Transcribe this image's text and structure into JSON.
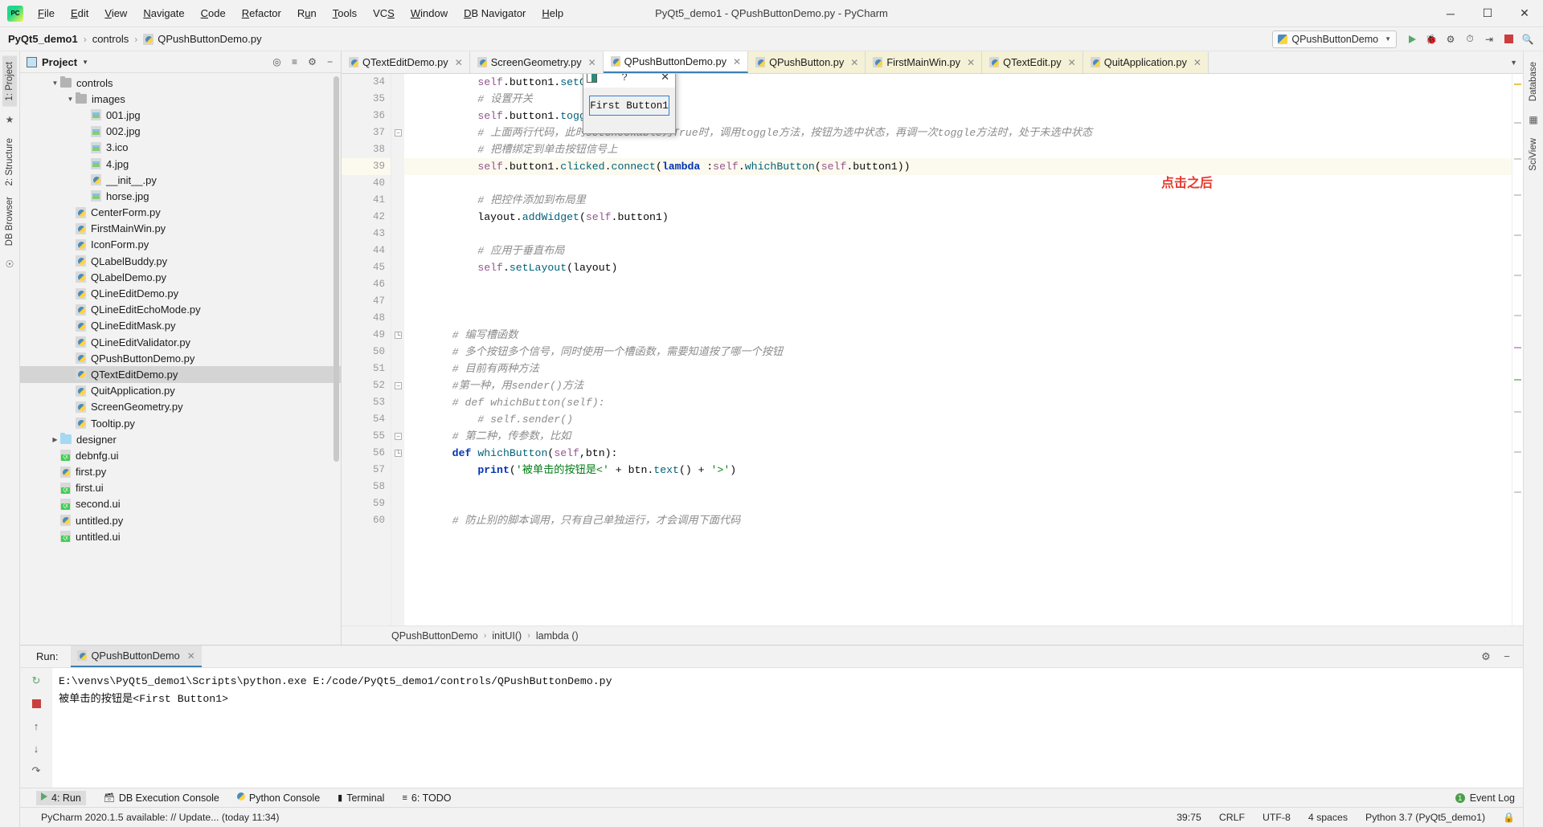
{
  "titlebar": {
    "logo_icon": "pycharm-logo-icon",
    "window_title": "PyQt5_demo1 - QPushButtonDemo.py - PyCharm",
    "menus": [
      "File",
      "Edit",
      "View",
      "Navigate",
      "Code",
      "Refactor",
      "Run",
      "Tools",
      "VCS",
      "Window",
      "DB Navigator",
      "Help"
    ],
    "minimize": "─",
    "maximize": "☐",
    "close": "✕"
  },
  "navbar": {
    "crumbs": [
      "PyQt5_demo1",
      "controls",
      "QPushButtonDemo.py"
    ],
    "separator": "›",
    "run_config": "QPushButtonDemo",
    "icons": [
      "run-icon",
      "debug-icon",
      "coverage-icon",
      "profile-icon",
      "attach-icon",
      "stop-icon",
      "search-icon"
    ]
  },
  "left_strip": {
    "project_tab": "1: Project",
    "structure_tab": "2: Structure",
    "db_browser_tab": "DB Browser"
  },
  "right_strip": {
    "database_tab": "Database",
    "sciview_tab": "SciView"
  },
  "project_panel": {
    "title": "Project",
    "tree": [
      {
        "label": "controls",
        "depth": 1,
        "type": "folder",
        "arrow": "▼",
        "selected": false
      },
      {
        "label": "images",
        "depth": 2,
        "type": "folder",
        "arrow": "▼",
        "selected": false
      },
      {
        "label": "001.jpg",
        "depth": 3,
        "type": "image",
        "arrow": "",
        "selected": false
      },
      {
        "label": "002.jpg",
        "depth": 3,
        "type": "image",
        "arrow": "",
        "selected": false
      },
      {
        "label": "3.ico",
        "depth": 3,
        "type": "image",
        "arrow": "",
        "selected": false
      },
      {
        "label": "4.jpg",
        "depth": 3,
        "type": "image",
        "arrow": "",
        "selected": false
      },
      {
        "label": "__init__.py",
        "depth": 3,
        "type": "python",
        "arrow": "",
        "selected": false
      },
      {
        "label": "horse.jpg",
        "depth": 3,
        "type": "image",
        "arrow": "",
        "selected": false
      },
      {
        "label": "CenterForm.py",
        "depth": 2,
        "type": "python",
        "arrow": "",
        "selected": false
      },
      {
        "label": "FirstMainWin.py",
        "depth": 2,
        "type": "python",
        "arrow": "",
        "selected": false
      },
      {
        "label": "IconForm.py",
        "depth": 2,
        "type": "python",
        "arrow": "",
        "selected": false
      },
      {
        "label": "QLabelBuddy.py",
        "depth": 2,
        "type": "python",
        "arrow": "",
        "selected": false
      },
      {
        "label": "QLabelDemo.py",
        "depth": 2,
        "type": "python",
        "arrow": "",
        "selected": false
      },
      {
        "label": "QLineEditDemo.py",
        "depth": 2,
        "type": "python",
        "arrow": "",
        "selected": false
      },
      {
        "label": "QLineEditEchoMode.py",
        "depth": 2,
        "type": "python",
        "arrow": "",
        "selected": false
      },
      {
        "label": "QLineEditMask.py",
        "depth": 2,
        "type": "python",
        "arrow": "",
        "selected": false
      },
      {
        "label": "QLineEditValidator.py",
        "depth": 2,
        "type": "python",
        "arrow": "",
        "selected": false
      },
      {
        "label": "QPushButtonDemo.py",
        "depth": 2,
        "type": "python",
        "arrow": "",
        "selected": false
      },
      {
        "label": "QTextEditDemo.py",
        "depth": 2,
        "type": "python",
        "arrow": "",
        "selected": true
      },
      {
        "label": "QuitApplication.py",
        "depth": 2,
        "type": "python",
        "arrow": "",
        "selected": false
      },
      {
        "label": "ScreenGeometry.py",
        "depth": 2,
        "type": "python",
        "arrow": "",
        "selected": false
      },
      {
        "label": "Tooltip.py",
        "depth": 2,
        "type": "python",
        "arrow": "",
        "selected": false
      },
      {
        "label": "designer",
        "depth": 1,
        "type": "folderblue",
        "arrow": "▶",
        "selected": false
      },
      {
        "label": "debnfg.ui",
        "depth": 1,
        "type": "qtui",
        "arrow": "",
        "selected": false
      },
      {
        "label": "first.py",
        "depth": 1,
        "type": "python",
        "arrow": "",
        "selected": false
      },
      {
        "label": "first.ui",
        "depth": 1,
        "type": "qtui",
        "arrow": "",
        "selected": false
      },
      {
        "label": "second.ui",
        "depth": 1,
        "type": "qtui",
        "arrow": "",
        "selected": false
      },
      {
        "label": "untitled.py",
        "depth": 1,
        "type": "python",
        "arrow": "",
        "selected": false
      },
      {
        "label": "untitled.ui",
        "depth": 1,
        "type": "qtui",
        "arrow": "",
        "selected": false
      }
    ]
  },
  "editor": {
    "tabs": [
      {
        "label": "QTextEditDemo.py",
        "active": false,
        "modified": false
      },
      {
        "label": "ScreenGeometry.py",
        "active": false,
        "modified": false
      },
      {
        "label": "QPushButtonDemo.py",
        "active": true,
        "modified": false
      },
      {
        "label": "QPushButton.py",
        "active": false,
        "modified": true
      },
      {
        "label": "FirstMainWin.py",
        "active": false,
        "modified": true
      },
      {
        "label": "QTextEdit.py",
        "active": false,
        "modified": true
      },
      {
        "label": "QuitApplication.py",
        "active": false,
        "modified": true
      }
    ],
    "close_glyph": "✕",
    "first_line_number": 34,
    "highlighted_line": 39,
    "lines": [
      "        self.button1.setCheckable(True)",
      "        # 设置开关",
      "        self.button1.toggle()",
      "        # 上面两行代码，此时setCheckable为True时，调用toggle方法，按钮为选中状态，再调一次toggle方法时，处于未选中状态",
      "        # 把槽绑定到单击按钮信号上",
      "        self.button1.clicked.connect(lambda :self.whichButton(self.button1))",
      "",
      "        # 把控件添加到布局里",
      "        layout.addWidget(self.button1)",
      "",
      "        # 应用于垂直布局",
      "        self.setLayout(layout)",
      "",
      "",
      "",
      "    # 编写槽函数",
      "    # 多个按钮多个信号，同时使用一个槽函数，需要知道按了哪一个按钮",
      "    # 目前有两种方法",
      "    #第一种，用sender()方法",
      "    # def whichButton(self):",
      "        # self.sender()",
      "    # 第二种，传参数，比如",
      "    def whichButton(self,btn):",
      "        print('被单击的按钮是<' + btn.text() + '>')",
      "",
      "",
      "    # 防止别的脚本调用，只有自己单独运行，才会调用下面代码"
    ],
    "breadcrumb": [
      "QPushButtonDemo",
      "initUI()",
      "lambda ()"
    ],
    "annotation": "点击之后"
  },
  "qt_dialog": {
    "icon": "app-window-icon",
    "title": "?",
    "close": "✕",
    "button_label": "First Button1"
  },
  "run_window": {
    "label": "Run:",
    "tab": "QPushButtonDemo",
    "close_glyph": "✕",
    "settings_icon": "gear-icon",
    "hide_icon": "minimize-icon",
    "side_icons": [
      "rerun-icon",
      "stop-icon",
      "up-icon",
      "down-icon",
      "soft-wrap-icon"
    ],
    "console": [
      "E:\\venvs\\PyQt5_demo1\\Scripts\\python.exe E:/code/PyQt5_demo1/controls/QPushButtonDemo.py",
      "被单击的按钮是<First Button1>"
    ]
  },
  "bottom_strip": {
    "items": [
      {
        "label": "4: Run",
        "icon": "run-icon",
        "selected": true
      },
      {
        "label": "DB Execution Console",
        "icon": "db-icon",
        "selected": false
      },
      {
        "label": "Python Console",
        "icon": "python-icon",
        "selected": false
      },
      {
        "label": "Terminal",
        "icon": "terminal-icon",
        "selected": false
      },
      {
        "label": "6: TODO",
        "icon": "todo-icon",
        "selected": false
      }
    ],
    "event_log": "Event Log",
    "event_badge": "1"
  },
  "status_bar": {
    "message": "PyCharm 2020.1.5 available: // Update... (today 11:34)",
    "caret": "39:75",
    "line_sep": "CRLF",
    "encoding": "UTF-8",
    "indent": "4 spaces",
    "interpreter": "Python 3.7 (PyQt5_demo1)",
    "lock_icon": "lock-icon"
  }
}
